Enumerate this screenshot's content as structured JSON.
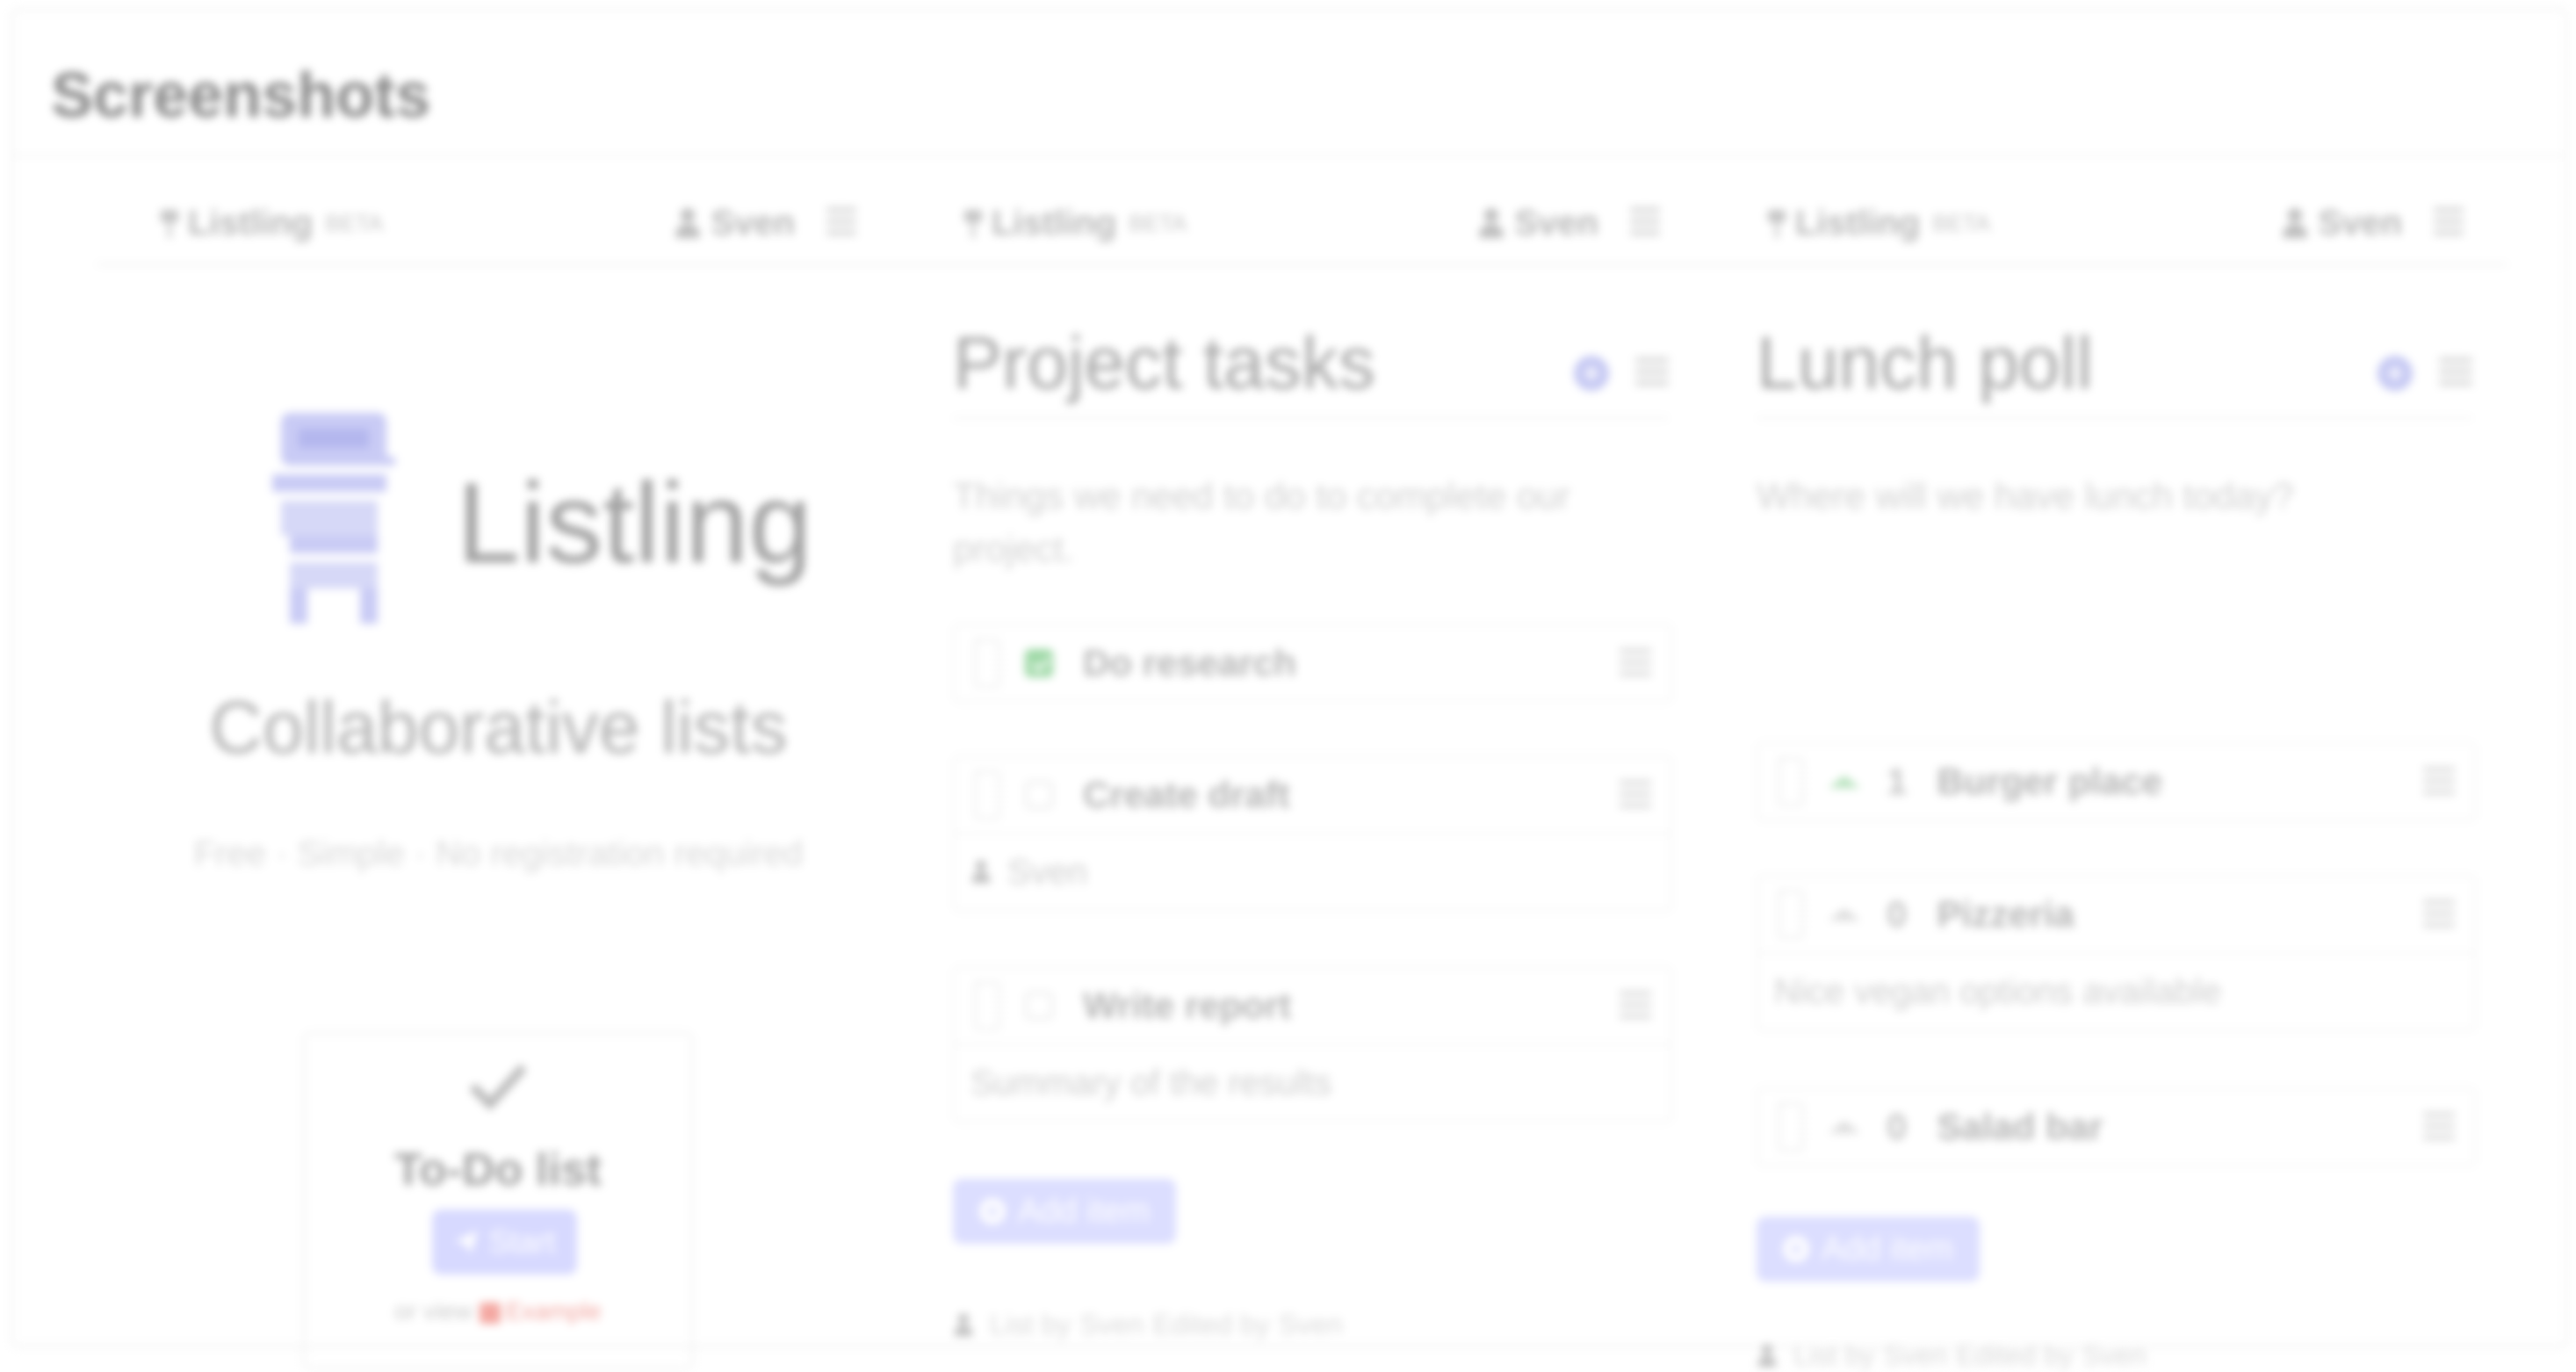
{
  "page": {
    "title": "Screenshots"
  },
  "panels": [
    {
      "navbar": {
        "brand": "Listling",
        "beta": "BETA",
        "user": "Sven"
      },
      "landing": {
        "logo_text": "Listling",
        "tagline": "Collaborative lists",
        "subline": "Free · Simple · No registration required",
        "template_card": {
          "icon": "check-icon",
          "title": "To-Do list",
          "start_label": "Start",
          "footer_prefix": "or view",
          "footer_example": "Example"
        }
      }
    },
    {
      "navbar": {
        "brand": "Listling",
        "beta": "BETA",
        "user": "Sven"
      },
      "list": {
        "title": "Project tasks",
        "description": "Things we need to do to complete our project.",
        "items": [
          {
            "label": "Do research",
            "checked": true,
            "note": ""
          },
          {
            "label": "Create draft",
            "checked": false,
            "note": "Sven",
            "note_icon": "person-icon"
          },
          {
            "label": "Write report",
            "checked": false,
            "note": "Summary of the results"
          }
        ],
        "add_label": "Add item",
        "meta": {
          "list_by": "List by",
          "user1": "Sven",
          "edited_by": "Edited by",
          "user2": "Sven"
        }
      }
    },
    {
      "navbar": {
        "brand": "Listling",
        "beta": "BETA",
        "user": "Sven"
      },
      "list": {
        "title": "Lunch poll",
        "description": "Where will we have lunch today?",
        "items": [
          {
            "votes": "1",
            "label": "Burger place",
            "voted": true,
            "note": ""
          },
          {
            "votes": "0",
            "label": "Pizzeria",
            "voted": false,
            "note": "Nice vegan options available"
          },
          {
            "votes": "0",
            "label": "Salad bar",
            "voted": false,
            "note": ""
          }
        ],
        "add_label": "Add item",
        "meta": {
          "list_by": "List by",
          "user1": "Sven",
          "edited_by": "Edited by",
          "user2": "Sven"
        }
      }
    }
  ],
  "colors": {
    "accent": "#d7d9ff",
    "check_green": "#9fd9a7",
    "example_red": "#f4a8a2"
  }
}
